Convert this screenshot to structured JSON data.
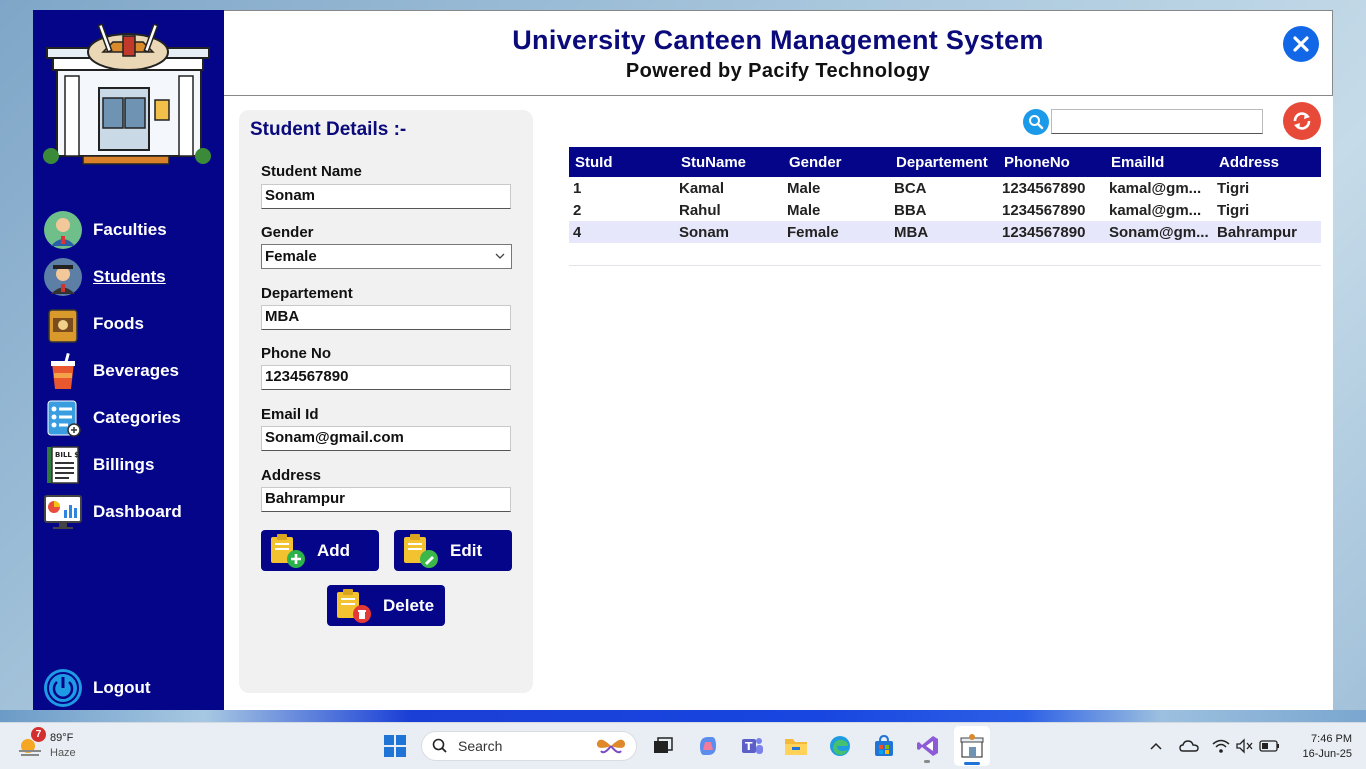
{
  "app": {
    "title": "University Canteen Management System",
    "subtitle": "Powered by Pacify Technology"
  },
  "sidebar": {
    "items": [
      {
        "label": "Faculties",
        "icon": "faculty-avatar-icon"
      },
      {
        "label": "Students",
        "icon": "student-avatar-icon",
        "active": true
      },
      {
        "label": "Foods",
        "icon": "food-bag-icon"
      },
      {
        "label": "Beverages",
        "icon": "drink-cup-icon"
      },
      {
        "label": "Categories",
        "icon": "list-icon"
      },
      {
        "label": "Billings",
        "icon": "bill-icon"
      },
      {
        "label": "Dashboard",
        "icon": "dashboard-monitor-icon"
      }
    ],
    "logout": "Logout"
  },
  "form": {
    "title": "Student Details :-",
    "name_label": "Student Name",
    "name_value": "Sonam",
    "gender_label": "Gender",
    "gender_value": "Female",
    "dept_label": "Departement",
    "dept_value": "MBA",
    "phone_label": "Phone No",
    "phone_value": "1234567890",
    "email_label": "Email Id",
    "email_value": "Sonam@gmail.com",
    "address_label": "Address",
    "address_value": "Bahrampur",
    "add_label": "Add",
    "edit_label": "Edit",
    "delete_label": "Delete"
  },
  "search": {
    "value": ""
  },
  "grid": {
    "columns": [
      "StuId",
      "StuName",
      "Gender",
      "Departement",
      "PhoneNo",
      "EmailId",
      "Address"
    ],
    "rows": [
      [
        "1",
        "Kamal",
        "Male",
        "BCA",
        "1234567890",
        "kamal@gm...",
        "Tigri"
      ],
      [
        "2",
        "Rahul",
        "Male",
        "BBA",
        "1234567890",
        "kamal@gm...",
        "Tigri"
      ],
      [
        "4",
        "Sonam",
        "Female",
        "MBA",
        "1234567890",
        "Sonam@gm...",
        "Bahrampur"
      ]
    ],
    "selected_row": 2
  },
  "taskbar": {
    "weather_badge": "7",
    "temperature": "89°F",
    "condition": "Haze",
    "search_placeholder": "Search",
    "time": "7:46 PM",
    "date": "16-Jun-25"
  },
  "colors": {
    "sidebar": "#05058a",
    "title": "#0a0a7a",
    "close": "#1267e6",
    "refresh": "#e84a3a",
    "selected_row": "#e7e7fb"
  }
}
